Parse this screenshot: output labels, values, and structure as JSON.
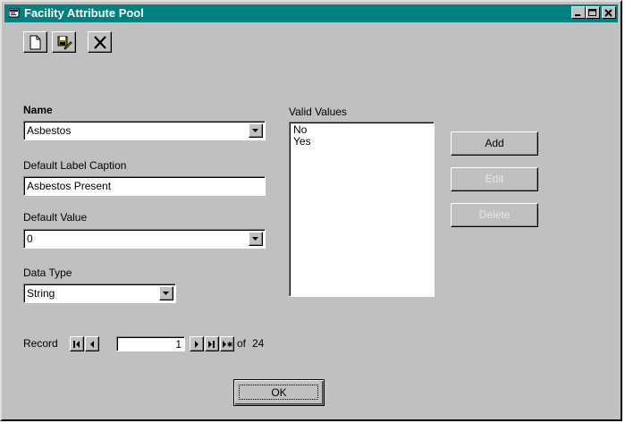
{
  "window": {
    "title": "Facility Attribute Pool",
    "title_bar_color": "#008080",
    "face_color": "#c0c0c0"
  },
  "title_bar_buttons": [
    "minimize-icon",
    "maximize-icon",
    "close-icon"
  ],
  "toolbar": {
    "buttons": [
      "new-document-icon",
      "save-edit-icon",
      "delete-x-icon"
    ]
  },
  "form": {
    "name_label": "Name",
    "name_value": "Asbestos",
    "caption_label": "Default Label Caption",
    "caption_value": "Asbestos Present",
    "default_value_label": "Default Value",
    "default_value": "0",
    "data_type_label": "Data Type",
    "data_type_value": "String"
  },
  "valid_values": {
    "label": "Valid Values",
    "items": [
      "No",
      "Yes"
    ]
  },
  "actions": {
    "add": "Add",
    "edit": "Edit",
    "delete": "Delete",
    "edit_enabled": false,
    "delete_enabled": false
  },
  "record_nav": {
    "label": "Record",
    "current": "1",
    "of_label": "of",
    "total": "24"
  },
  "ok_label": "OK"
}
